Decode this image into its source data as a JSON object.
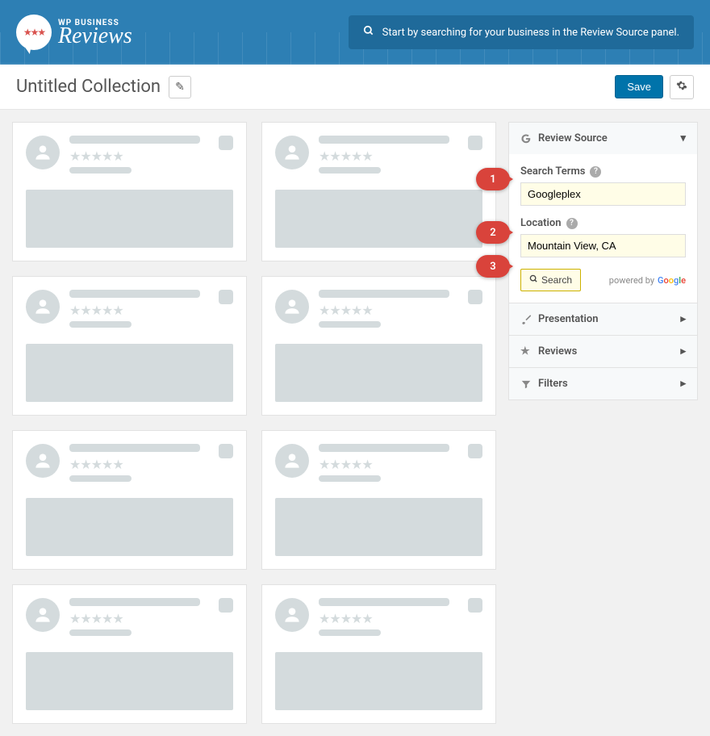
{
  "header": {
    "logo_top": "WP BUSINESS",
    "logo_script": "Reviews",
    "tip": "Start by searching for your business in the Review Source panel."
  },
  "titlebar": {
    "title": "Untitled Collection",
    "save": "Save"
  },
  "sidebar": {
    "review_source": {
      "title": "Review Source",
      "search_terms_label": "Search Terms",
      "search_terms_value": "Googleplex",
      "location_label": "Location",
      "location_value": "Mountain View, CA",
      "search_button": "Search",
      "powered_by": "powered by"
    },
    "panels": [
      {
        "label": "Presentation"
      },
      {
        "label": "Reviews"
      },
      {
        "label": "Filters"
      }
    ]
  },
  "callouts": [
    "1",
    "2",
    "3"
  ]
}
